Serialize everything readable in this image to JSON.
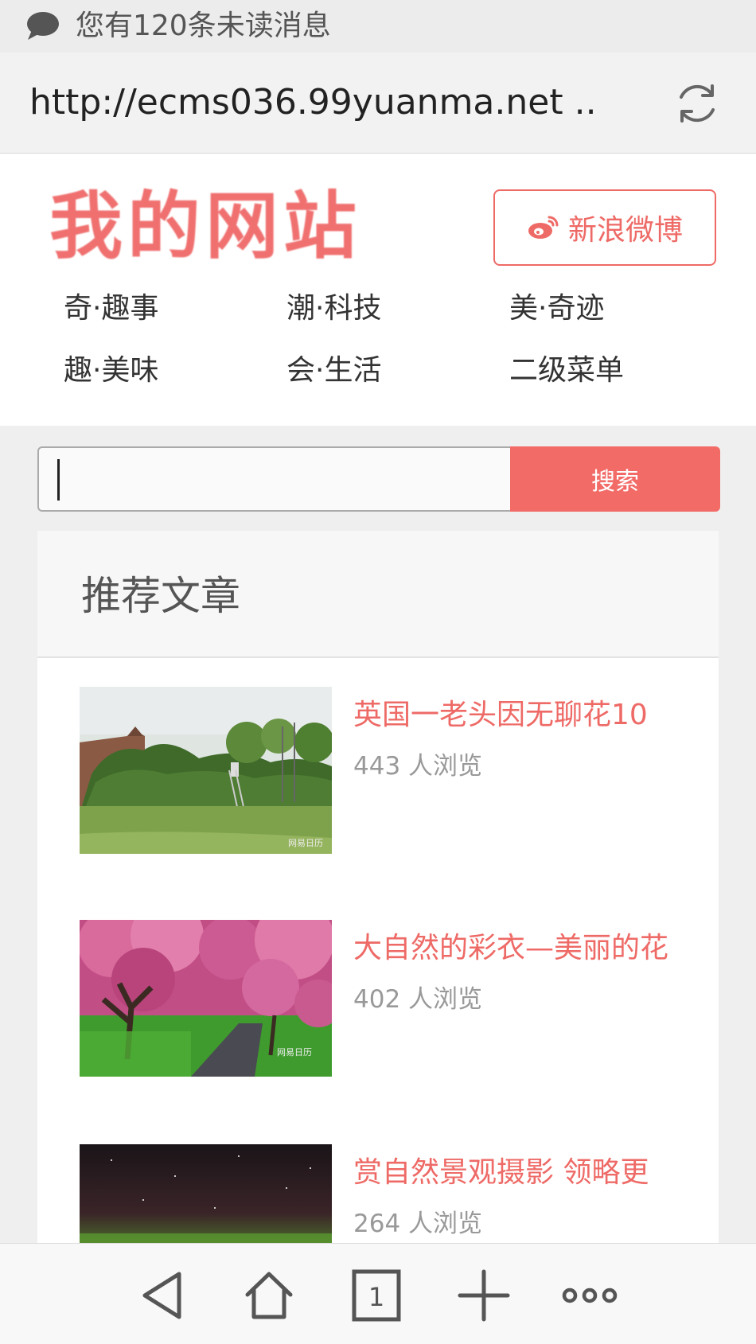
{
  "notification": {
    "text": "您有120条未读消息"
  },
  "browser": {
    "url": "http://ecms036.99yuanma.net .."
  },
  "site": {
    "logo_text": "我的网站",
    "weibo_label": "新浪微博",
    "nav": [
      "奇·趣事",
      "潮·科技",
      "美·奇迹",
      "趣·美味",
      "会·生活",
      "二级菜单"
    ]
  },
  "search": {
    "button_label": "搜索",
    "value": ""
  },
  "section": {
    "title": "推荐文章",
    "articles": [
      {
        "title": "英国一老头因无聊花10",
        "views": "443 人浏览",
        "watermark": "网易日历"
      },
      {
        "title": "大自然的彩衣—美丽的花",
        "views": "402 人浏览",
        "watermark": "网易日历"
      },
      {
        "title": "赏自然景观摄影 领略更",
        "views": "264 人浏览"
      }
    ]
  },
  "toolbar": {
    "tab_count": "1"
  },
  "colors": {
    "accent": "#f26b67",
    "link": "#ee6a66"
  }
}
